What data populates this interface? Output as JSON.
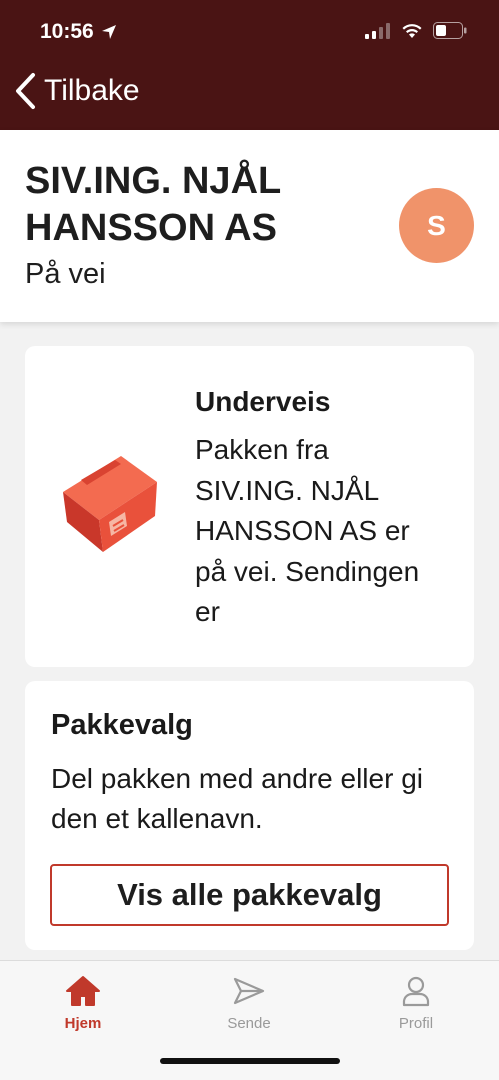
{
  "status_bar": {
    "time": "10:56"
  },
  "nav": {
    "back_label": "Tilbake"
  },
  "header": {
    "company": "SIV.ING. NJÅL HANSSON AS",
    "status": "På vei",
    "avatar_initial": "S"
  },
  "tracking_card": {
    "title": "Underveis",
    "body": "Pakken fra SIV.ING. NJÅL HANSSON AS er på vei. Sendingen er"
  },
  "options_card": {
    "title": "Pakkevalg",
    "body": "Del pakken med andre eller gi den et kallenavn.",
    "button_label": "Vis alle pakkevalg"
  },
  "tabbar": {
    "items": [
      {
        "label": "Hjem",
        "icon": "home-icon",
        "active": true
      },
      {
        "label": "Sende",
        "icon": "send-icon",
        "active": false
      },
      {
        "label": "Profil",
        "icon": "profile-icon",
        "active": false
      }
    ]
  },
  "colors": {
    "topbar": "#4a1414",
    "accent": "#c0392b",
    "avatar": "#f0936a"
  }
}
